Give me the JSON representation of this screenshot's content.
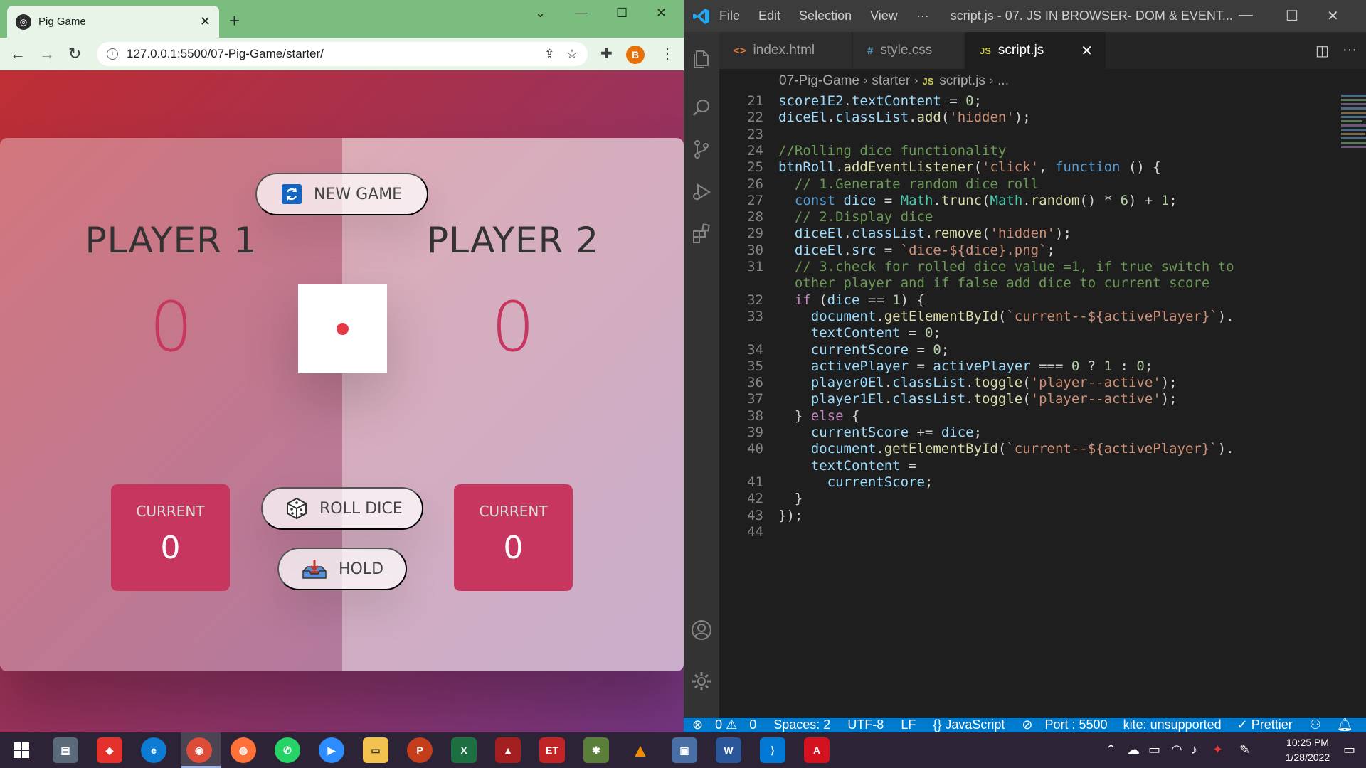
{
  "browser": {
    "tab_title": "Pig Game",
    "url": "127.0.0.1:5500/07-Pig-Game/starter/",
    "profile_initial": "B"
  },
  "game": {
    "new_game_label": "NEW GAME",
    "roll_dice_label": "ROLL DICE",
    "hold_label": "HOLD",
    "players": [
      {
        "name": "PLAYER 1",
        "score": "0",
        "current_label": "CURRENT",
        "current_score": "0"
      },
      {
        "name": "PLAYER 2",
        "score": "0",
        "current_label": "CURRENT",
        "current_score": "0"
      }
    ],
    "dice_value": 1,
    "colors": {
      "accent": "#c7365f",
      "dice_pip": "#e63946",
      "bg_from": "#bf2e34",
      "bg_to": "#753682"
    }
  },
  "vscode": {
    "menu": [
      "File",
      "Edit",
      "Selection",
      "View",
      "···"
    ],
    "window_title": "script.js - 07. JS IN BROWSER- DOM & EVENT...",
    "tabs": [
      {
        "icon": "<>",
        "label": "index.html"
      },
      {
        "icon": "#",
        "label": "style.css"
      },
      {
        "icon": "JS",
        "label": "script.js"
      }
    ],
    "breadcrumb": [
      "07-Pig-Game",
      "starter",
      "script.js",
      "..."
    ],
    "line_numbers": [
      "21",
      "22",
      "23",
      "24",
      "25",
      "26",
      "27",
      "28",
      "29",
      "30",
      "31",
      "",
      "32",
      "33",
      "",
      "34",
      "35",
      "36",
      "37",
      "38",
      "39",
      "40",
      "",
      "41",
      "42",
      "43",
      "44"
    ],
    "code_lines": [
      "score1E2.textContent = 0;",
      "diceEl.classList.add('hidden');",
      "",
      "//Rolling dice functionality",
      "btnRoll.addEventListener('click', function () {",
      "  // 1.Generate random dice roll",
      "  const dice = Math.trunc(Math.random() * 6) + 1;",
      "  // 2.Display dice",
      "  diceEl.classList.remove('hidden');",
      "  diceEl.src = `dice-${dice}.png`;",
      "  // 3.check for rolled dice value =1, if true switch to",
      "  other player and if false add dice to current score",
      "  if (dice == 1) {",
      "    document.getElementById(`current--${activePlayer}`).",
      "    textContent = 0;",
      "    currentScore = 0;",
      "    activePlayer = activePlayer === 0 ? 1 : 0;",
      "    player0El.classList.toggle('player--active');",
      "    player1El.classList.toggle('player--active');",
      "  } else {",
      "    currentScore += dice;",
      "    document.getElementById(`current--${activePlayer}`).",
      "    textContent =",
      "      currentScore;",
      "  }",
      "});",
      ""
    ],
    "status": {
      "errors": "0",
      "warnings": "0",
      "spaces": "Spaces: 2",
      "encoding": "UTF-8",
      "eol": "LF",
      "language": "{} JavaScript",
      "port": "Port : 5500",
      "kite": "kite: unsupported",
      "prettier": "✓ Prettier"
    }
  },
  "taskbar": {
    "time": "10:25 PM",
    "date": "1/28/2022"
  }
}
